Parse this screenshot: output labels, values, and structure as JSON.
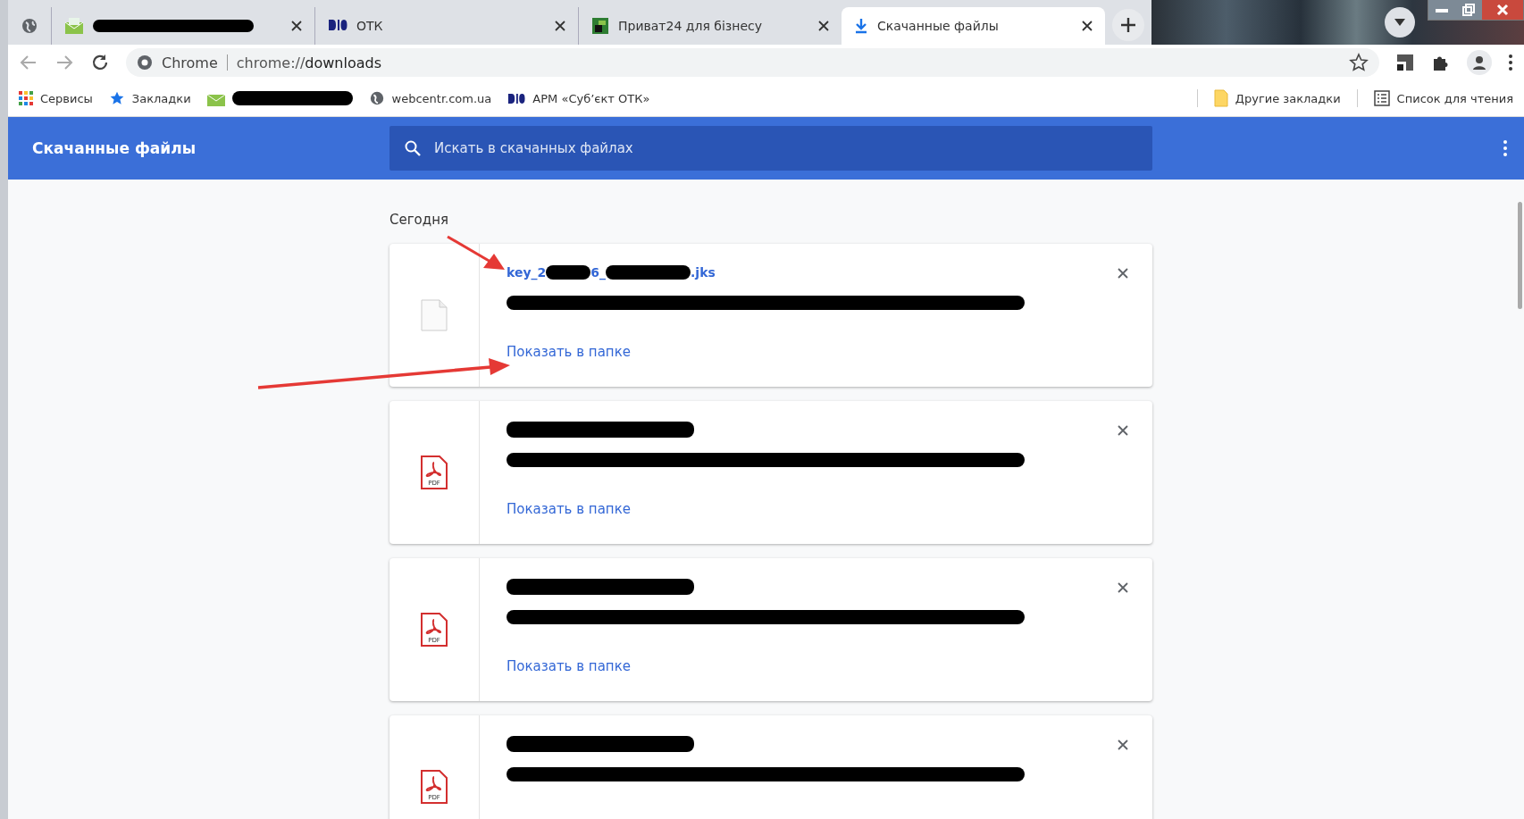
{
  "tabs": [
    {
      "kind": "redacted",
      "selected": false
    },
    {
      "kind": "dio",
      "title": "ОТК",
      "selected": false
    },
    {
      "kind": "privat",
      "title": "Приват24 для бізнесу",
      "selected": false
    },
    {
      "kind": "download",
      "title": "Скачанные файлы",
      "selected": true
    }
  ],
  "address_bar": {
    "site": "Chrome",
    "url_prefix": "chrome://",
    "url_path": "downloads"
  },
  "bookmarks": [
    {
      "kind": "apps",
      "label": "Сервисы"
    },
    {
      "kind": "star",
      "label": "Закладки"
    },
    {
      "kind": "redacted"
    },
    {
      "kind": "globe",
      "label": "webcentr.com.ua"
    },
    {
      "kind": "dio",
      "label": "АРМ «Суб’єкт ОТК»"
    }
  ],
  "bookmarks_right": [
    {
      "kind": "folder",
      "label": "Другие закладки"
    },
    {
      "kind": "reading",
      "label": "Список для чтения"
    }
  ],
  "header": {
    "title": "Скачанные файлы",
    "search_placeholder": "Искать в скачанных файлах"
  },
  "section": "Сегодня",
  "downloads": [
    {
      "kind": "file",
      "name_parts": [
        "key_2",
        "6_",
        ".jks"
      ],
      "show_in_folder": "Показать в папке"
    },
    {
      "kind": "pdf",
      "icon_label": "PDF",
      "show_in_folder": "Показать в папке"
    },
    {
      "kind": "pdf",
      "icon_label": "PDF",
      "show_in_folder": "Показать в папке"
    },
    {
      "kind": "pdf",
      "icon_label": "PDF"
    }
  ]
}
